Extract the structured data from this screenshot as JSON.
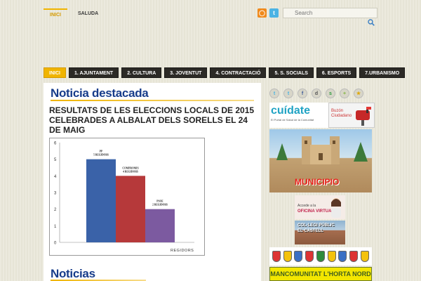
{
  "topnav": [
    {
      "label": "INICI",
      "active": true
    },
    {
      "label": "SALUDA",
      "active": false
    }
  ],
  "search": {
    "placeholder": "Search"
  },
  "mainnav": [
    {
      "label": "INICI",
      "active": true
    },
    {
      "label": "1. AJUNTAMENT",
      "active": false
    },
    {
      "label": "2. CULTURA",
      "active": false
    },
    {
      "label": "3. JOVENTUT",
      "active": false
    },
    {
      "label": "4. CONTRACTACIÓ",
      "active": false
    },
    {
      "label": "5. S. SOCIALS",
      "active": false
    },
    {
      "label": "6. ESPORTS",
      "active": false
    },
    {
      "label": "7.URBANISMO",
      "active": false
    }
  ],
  "main": {
    "featured_title": "Noticia destacada",
    "headline": "RESULTATS DE LES ELECCIONS LOCALS DE 2015 CELEBRADES A ALBALAT DELS SORELLS EL 24 DE MAIG",
    "news_title": "Noticias"
  },
  "chart_data": {
    "type": "bar",
    "categories": [
      "PP",
      "COMPROMÍS",
      "PSOE"
    ],
    "values": [
      5,
      4,
      2
    ],
    "data_labels": [
      "PP 5 REGIDORS",
      "COMPROMIS 4 REGIDORS",
      "PSOE 2 REGIDORS"
    ],
    "colors": [
      "#3a62a8",
      "#b6393a",
      "#7c5aa0"
    ],
    "xlabel": "REGIDORS",
    "ylabel": "",
    "ylim": [
      0,
      6
    ],
    "yticks": [
      0,
      1,
      2,
      3,
      4,
      5,
      6
    ],
    "grid": false
  },
  "sidebar": {
    "social_icons": [
      "twitter-icon",
      "twitter-icon",
      "facebook-icon",
      "digg-icon",
      "stumbleupon-icon",
      "plus-icon",
      "star-icon"
    ],
    "cuidate_title": "cuídate",
    "cuidate_subtitle": "El Portal de Salud de la Comunitat",
    "buzon_label": "Buzón Ciudadano",
    "municipio_label": "MUNICIPIO",
    "virtual_label": "OFICINA VIRTUAL",
    "virtual_small": "Accede a la",
    "colegi_label_1": "COL·LEGI PÚBLIC",
    "colegi_label_2": "EL CASTELL",
    "mancomunitat_label": "MANCOMUNITAT L'HORTA NORD"
  }
}
